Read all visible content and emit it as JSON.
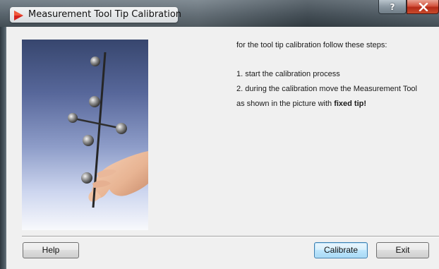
{
  "window": {
    "title": "Measurement Tool Tip Calibration",
    "app_icon": "red-arrow-icon",
    "help_button_label": "?",
    "close_icon": "close-icon"
  },
  "photo": {
    "subject": "hand-holding-measurement-tool"
  },
  "instructions": {
    "intro": "for the tool tip calibration follow these steps:",
    "step1": "1. start the calibration process",
    "step2_line1": "2. during the calibration move the Measurement Tool",
    "step2_line2_prefix": "as shown in the picture with ",
    "step2_bold": "fixed tip!"
  },
  "buttons": {
    "help": "Help",
    "calibrate": "Calibrate",
    "exit": "Exit"
  },
  "colors": {
    "accent_focus_button": "#3c7fb1",
    "close_button": "#c94b2c",
    "app_icon": "#d4231f"
  }
}
